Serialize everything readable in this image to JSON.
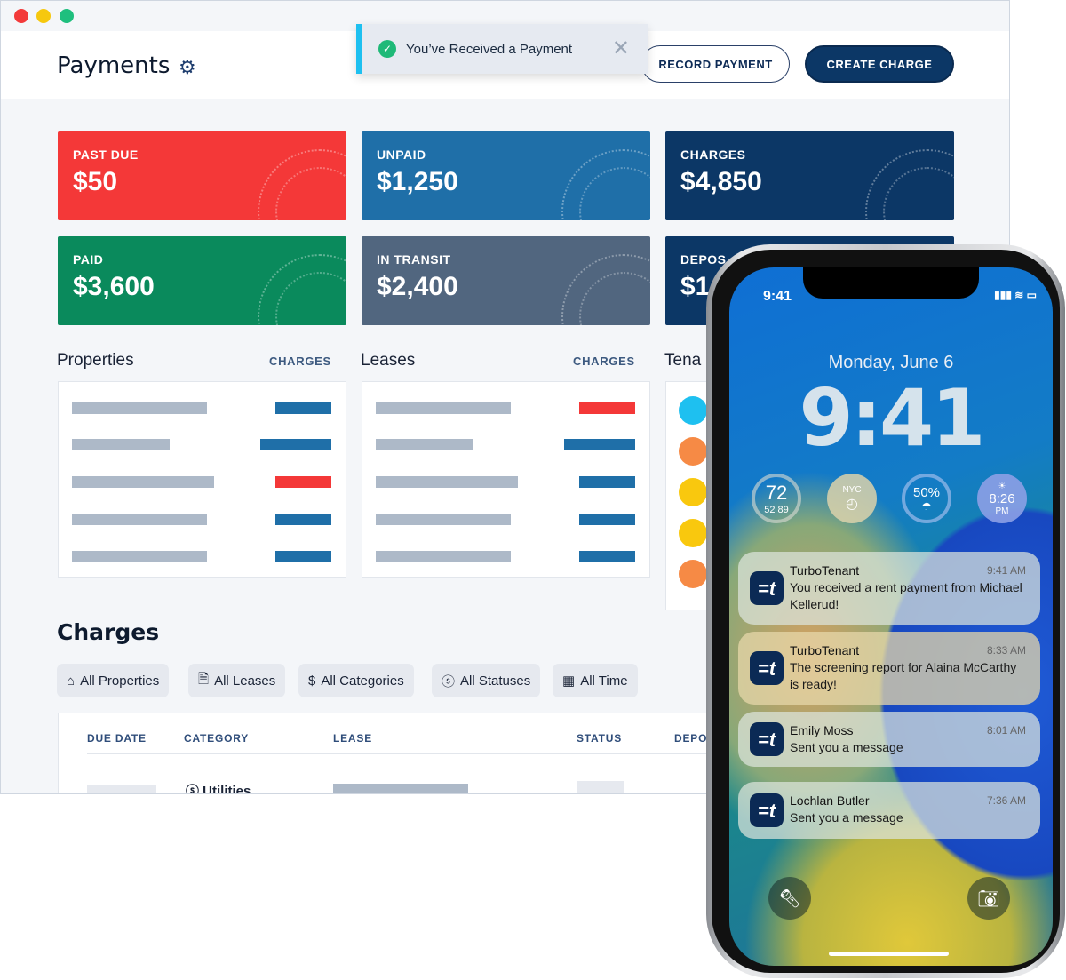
{
  "header": {
    "title": "Payments",
    "record_payment": "RECORD PAYMENT",
    "create_charge": "CREATE CHARGE"
  },
  "toast": {
    "message": "You’ve Received a Payment"
  },
  "cards": [
    {
      "label": "PAST DUE",
      "value": "$50",
      "color": "#f43838"
    },
    {
      "label": "UNPAID",
      "value": "$1,250",
      "color": "#1f6fa8"
    },
    {
      "label": "CHARGES",
      "value": "$4,850",
      "color": "#0c3766"
    },
    {
      "label": "PAID",
      "value": "$3,600",
      "color": "#0a8a5c"
    },
    {
      "label": "IN TRANSIT",
      "value": "$2,400",
      "color": "#51667f"
    },
    {
      "label": "DEPOS",
      "value": "$1",
      "color": "#0c3766"
    }
  ],
  "sections": {
    "properties": "Properties",
    "leases": "Leases",
    "tenants": "Tena",
    "charges_link": "CHARGES"
  },
  "charges": {
    "title": "Charges",
    "filters": [
      "All Properties",
      "All Leases",
      "All Categories",
      "All Statuses",
      "All Time"
    ],
    "columns": [
      "DUE DATE",
      "CATEGORY",
      "LEASE",
      "STATUS",
      "DEPOS"
    ],
    "row_category": "Utilities"
  },
  "phone": {
    "status_time": "9:41",
    "date": "Monday, June 6",
    "clock": "9:41",
    "widgets": {
      "temp": "72",
      "low": "52",
      "high": "89",
      "clock_city": "NYC",
      "rain": "50%",
      "sunset": "8:26",
      "sunset_ampm": "PM"
    },
    "notifications": [
      {
        "app": "TurboTenant",
        "time": "9:41 AM",
        "text": "You received a rent payment from Michael Kellerud!"
      },
      {
        "app": "TurboTenant",
        "time": "8:33 AM",
        "text": "The screening report for Alaina McCarthy is ready!"
      },
      {
        "app": "Emily Moss",
        "time": "8:01 AM",
        "text": "Sent you a message"
      },
      {
        "app": "Lochlan Butler",
        "time": "7:36 AM",
        "text": "Sent you a message"
      }
    ],
    "app_icon": "=t"
  }
}
